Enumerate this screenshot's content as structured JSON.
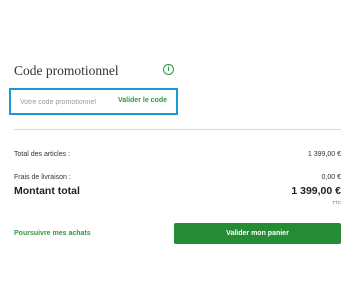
{
  "promo": {
    "title": "Code promotionnel",
    "info_icon_glyph": "i",
    "input_placeholder": "Votre code promotionnel",
    "input_value": "",
    "validate_label": "Valider le code"
  },
  "summary": {
    "articles_label": "Total des articles :",
    "articles_value": "1 399,00 €",
    "shipping_label": "Frais de livraison :",
    "shipping_value": "0,00 €",
    "total_label": "Montant total",
    "total_value": "1 399,00 €",
    "tax_note": "TTC"
  },
  "actions": {
    "continue_label": "Poursuivre mes achats",
    "checkout_label": "Valider mon panier"
  },
  "colors": {
    "accent_green": "#2e9a3c",
    "button_green": "#258c35",
    "focus_blue": "#1a9ad6"
  }
}
